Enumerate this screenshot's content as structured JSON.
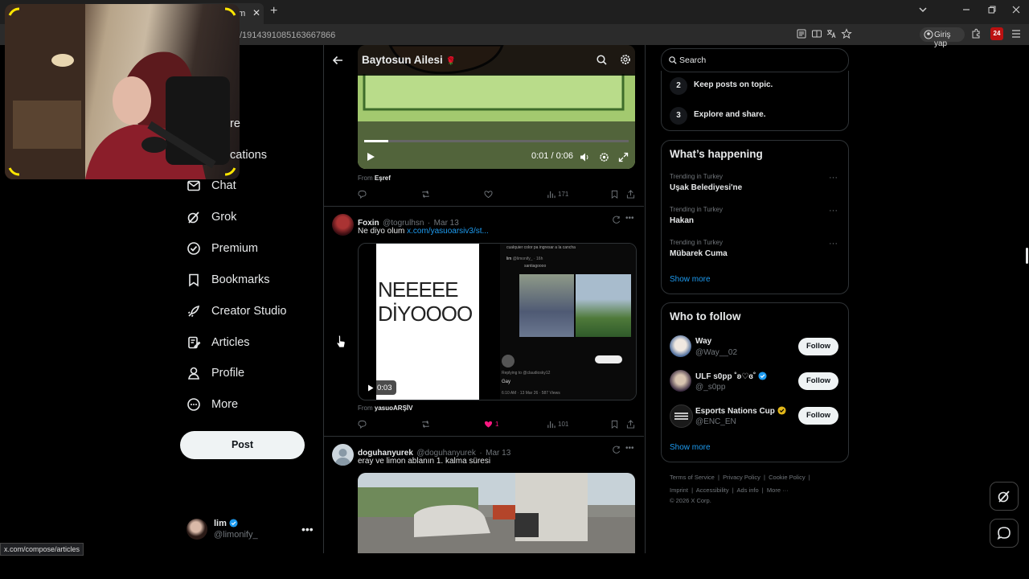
{
  "browser": {
    "tab_suffix": "om",
    "tab_close": "✕",
    "new_tab": "+",
    "url": "/1914391085163667866",
    "signin_label": "Giriş yap",
    "extension_badge": "24",
    "status_url": "x.com/compose/articles"
  },
  "nav": {
    "partial_1": "re",
    "partial_2": "cations",
    "items": [
      {
        "label": "Chat"
      },
      {
        "label": "Grok"
      },
      {
        "label": "Premium"
      },
      {
        "label": "Bookmarks"
      },
      {
        "label": "Creator Studio"
      },
      {
        "label": "Articles"
      },
      {
        "label": "Profile"
      },
      {
        "label": "More"
      }
    ],
    "post_label": "Post",
    "account": {
      "name": "lim",
      "handle": "@limonify_",
      "more": "•••"
    }
  },
  "header": {
    "title": "Baytosun Ailesi",
    "title_emoji": "🌹"
  },
  "tweets": [
    {
      "video_time": "0:01 / 0:06",
      "from_label": "From",
      "from_name": "Eşref",
      "views": "171"
    },
    {
      "name": "Foxin",
      "handle": "@togrulhsn",
      "date": "Mar 13",
      "text": "Ne diyo olum",
      "link": "x.com/yasuoarsiv3/st...",
      "media_text_1": "NEEEEE",
      "media_text_2": "DİYOOOO",
      "video_time": "0:03",
      "embed_caption": "cualquier color pa ingresar a la cancha",
      "embed_user": "lim",
      "embed_handle": "@limonify_ · 16h",
      "embed_sub": "santiagoooo",
      "embed_reply": "Replying to @claudiosky12",
      "embed_reply_text": "Gay",
      "embed_time": "6:10 AM · 13 Mar 26 · 587 Views",
      "from_label": "From",
      "from_name": "yasuoARŞİV",
      "likes": "1",
      "views": "101"
    },
    {
      "name": "doguhanyurek",
      "handle": "@doguhanyurek",
      "date": "Mar 13",
      "text": "eray ve limon ablanın 1. kalma süresi"
    }
  ],
  "right": {
    "search_placeholder": "Search",
    "rules": [
      {
        "num": "2",
        "text": "Keep posts on topic."
      },
      {
        "num": "3",
        "text": "Explore and share."
      }
    ],
    "trending_title": "What’s happening",
    "trends": [
      {
        "category": "Trending in Turkey",
        "name": "Uşak Belediyesi'ne"
      },
      {
        "category": "Trending in Turkey",
        "name": "Hakan"
      },
      {
        "category": "Trending in Turkey",
        "name": "Mübarek Cuma"
      }
    ],
    "show_more": "Show more",
    "wtf_title": "Who to follow",
    "follow_label": "Follow",
    "suggestions": [
      {
        "name": "Way",
        "handle": "@Way__02"
      },
      {
        "name": "ULF s0pp ˚ʚ♡ɞ˚",
        "handle": "@_s0pp"
      },
      {
        "name": "Esports Nations Cup",
        "handle": "@ENC_EN"
      }
    ],
    "footer": {
      "terms": "Terms of Service",
      "privacy": "Privacy Policy",
      "cookie": "Cookie Policy",
      "imprint": "Imprint",
      "accessibility": "Accessibility",
      "ads": "Ads info",
      "more": "More ···",
      "copyright": "© 2026 X Corp."
    }
  },
  "colors": {
    "accent": "#1d9bf0",
    "like": "#f91880",
    "verified": "#1d9bf0",
    "gold": "#e2b719"
  }
}
